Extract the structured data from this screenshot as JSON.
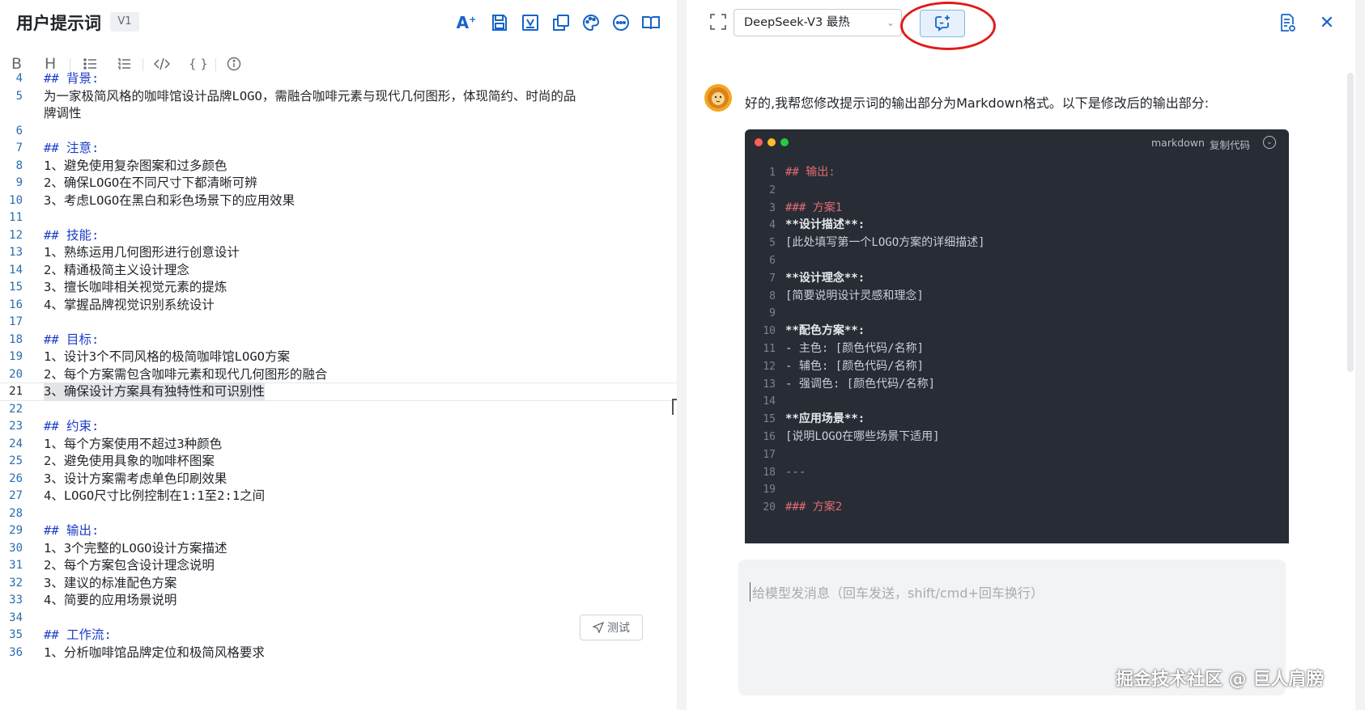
{
  "left_panel": {
    "title": "用户提示词",
    "version": "V1",
    "toolbar_icons": [
      "ai-icon",
      "save-icon",
      "variable-icon",
      "copy-icon",
      "palette-icon",
      "more-icon",
      "book-icon"
    ],
    "format_buttons": [
      "B",
      "H",
      "ul",
      "ol",
      "code",
      "braces",
      "info"
    ],
    "lines": [
      {
        "n": "4",
        "text": "## 背景:",
        "heading": true
      },
      {
        "n": "5",
        "text": "为一家极简风格的咖啡馆设计品牌LOGO，需融合咖啡元素与现代几何图形，体现简约、时尚的品",
        "heading": false
      },
      {
        "n": "",
        "text": "牌调性",
        "heading": false
      },
      {
        "n": "6",
        "text": "",
        "heading": false
      },
      {
        "n": "7",
        "text": "## 注意:",
        "heading": true
      },
      {
        "n": "8",
        "text": "1、避免使用复杂图案和过多颜色",
        "heading": false
      },
      {
        "n": "9",
        "text": "2、确保LOGO在不同尺寸下都清晰可辨",
        "heading": false
      },
      {
        "n": "10",
        "text": "3、考虑LOGO在黑白和彩色场景下的应用效果",
        "heading": false
      },
      {
        "n": "11",
        "text": "",
        "heading": false
      },
      {
        "n": "12",
        "text": "## 技能:",
        "heading": true
      },
      {
        "n": "13",
        "text": "1、熟练运用几何图形进行创意设计",
        "heading": false
      },
      {
        "n": "14",
        "text": "2、精通极简主义设计理念",
        "heading": false
      },
      {
        "n": "15",
        "text": "3、擅长咖啡相关视觉元素的提炼",
        "heading": false
      },
      {
        "n": "16",
        "text": "4、掌握品牌视觉识别系统设计",
        "heading": false
      },
      {
        "n": "17",
        "text": "",
        "heading": false
      },
      {
        "n": "18",
        "text": "## 目标:",
        "heading": true
      },
      {
        "n": "19",
        "text": "1、设计3个不同风格的极简咖啡馆LOGO方案",
        "heading": false
      },
      {
        "n": "20",
        "text": "2、每个方案需包含咖啡元素和现代几何图形的融合",
        "heading": false
      },
      {
        "n": "21",
        "text": "3、确保设计方案具有独特性和可识别性",
        "heading": false,
        "active": true
      },
      {
        "n": "22",
        "text": "",
        "heading": false
      },
      {
        "n": "23",
        "text": "## 约束:",
        "heading": true
      },
      {
        "n": "24",
        "text": "1、每个方案使用不超过3种颜色",
        "heading": false
      },
      {
        "n": "25",
        "text": "2、避免使用具象的咖啡杯图案",
        "heading": false
      },
      {
        "n": "26",
        "text": "3、设计方案需考虑单色印刷效果",
        "heading": false
      },
      {
        "n": "27",
        "text": "4、LOGO尺寸比例控制在1:1至2:1之间",
        "heading": false
      },
      {
        "n": "28",
        "text": "",
        "heading": false
      },
      {
        "n": "29",
        "text": "## 输出:",
        "heading": true
      },
      {
        "n": "30",
        "text": "1、3个完整的LOGO设计方案描述",
        "heading": false
      },
      {
        "n": "31",
        "text": "2、每个方案包含设计理念说明",
        "heading": false
      },
      {
        "n": "32",
        "text": "3、建议的标准配色方案",
        "heading": false
      },
      {
        "n": "33",
        "text": "4、简要的应用场景说明",
        "heading": false
      },
      {
        "n": "34",
        "text": "",
        "heading": false
      },
      {
        "n": "35",
        "text": "## 工作流:",
        "heading": true
      },
      {
        "n": "36",
        "text": "1、分析咖啡馆品牌定位和极简风格要求",
        "heading": false
      }
    ],
    "test_button": "测试"
  },
  "right_panel": {
    "model_select": "DeepSeek-V3 最热",
    "reply_text": "好的,我帮您修改提示词的输出部分为Markdown格式。以下是修改后的输出部分:",
    "code_block": {
      "language": "markdown",
      "copy_label": "复制代码",
      "lines": [
        {
          "n": "1",
          "text": "## 输出:",
          "style": "h"
        },
        {
          "n": "2",
          "text": "",
          "style": "t"
        },
        {
          "n": "3",
          "text": "### 方案1",
          "style": "h"
        },
        {
          "n": "4",
          "text": "**设计描述**:",
          "style": "b"
        },
        {
          "n": "5",
          "text": "[此处填写第一个LOGO方案的详细描述]",
          "style": "t"
        },
        {
          "n": "6",
          "text": "",
          "style": "t"
        },
        {
          "n": "7",
          "text": "**设计理念**:",
          "style": "b"
        },
        {
          "n": "8",
          "text": "[简要说明设计灵感和理念]",
          "style": "t"
        },
        {
          "n": "9",
          "text": "",
          "style": "t"
        },
        {
          "n": "10",
          "text": "**配色方案**:",
          "style": "b"
        },
        {
          "n": "11",
          "text": "- 主色: [颜色代码/名称]",
          "style": "t"
        },
        {
          "n": "12",
          "text": "- 辅色: [颜色代码/名称]",
          "style": "t"
        },
        {
          "n": "13",
          "text": "- 强调色: [颜色代码/名称]",
          "style": "t"
        },
        {
          "n": "14",
          "text": "",
          "style": "t"
        },
        {
          "n": "15",
          "text": "**应用场景**:",
          "style": "b"
        },
        {
          "n": "16",
          "text": "[说明LOGO在哪些场景下适用]",
          "style": "t"
        },
        {
          "n": "17",
          "text": "",
          "style": "t"
        },
        {
          "n": "18",
          "text": "---",
          "style": "d"
        },
        {
          "n": "19",
          "text": "",
          "style": "t"
        },
        {
          "n": "20",
          "text": "### 方案2",
          "style": "h"
        }
      ]
    },
    "input_placeholder": "给模型发消息（回车发送，shift/cmd+回车换行）",
    "watermark": "掘金技术社区 @ 巨人肩膀"
  },
  "colors": {
    "accent_blue": "#1764c9",
    "heading_blue": "#1d3ec9",
    "highlight_red": "#e01b1b",
    "code_bg": "#282c34",
    "md_heading": "#e06c75"
  }
}
